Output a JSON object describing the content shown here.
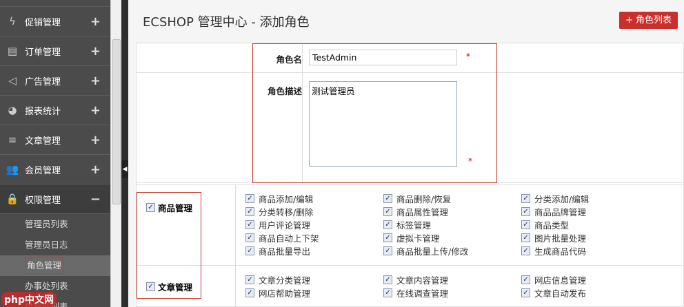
{
  "sidebar": {
    "items": [
      {
        "label": "促销管理",
        "icon": "lightning-icon",
        "toggle": "+"
      },
      {
        "label": "订单管理",
        "icon": "clipboard-icon",
        "toggle": "+"
      },
      {
        "label": "广告管理",
        "icon": "speaker-icon",
        "toggle": "+"
      },
      {
        "label": "报表统计",
        "icon": "pie-chart-icon",
        "toggle": "+"
      },
      {
        "label": "文章管理",
        "icon": "lines-icon",
        "toggle": "+"
      },
      {
        "label": "会员管理",
        "icon": "users-icon",
        "toggle": "+"
      },
      {
        "label": "权限管理",
        "icon": "lock-icon",
        "toggle": "−"
      }
    ],
    "subitems": [
      "管理员列表",
      "管理员日志",
      "角色管理",
      "办事处列表",
      "供货商列表"
    ]
  },
  "header": {
    "title": "ECSHOP 管理中心 - 添加角色",
    "button": "角色列表"
  },
  "form": {
    "name_label": "角色名",
    "name_value": "TestAdmin",
    "desc_label": "角色描述",
    "desc_value": "测试管理员",
    "required": "*"
  },
  "groups": [
    {
      "label": "商品管理",
      "items": [
        "商品添加/编辑",
        "商品删除/恢复",
        "分类添加/编辑",
        "分类转移/删除",
        "商品属性管理",
        "商品品牌管理",
        "用户评论管理",
        "标签管理",
        "商品类型",
        "商品自动上下架",
        "虚拟卡管理",
        "图片批量处理",
        "商品批量导出",
        "商品批量上传/修改",
        "生成商品代码"
      ]
    },
    {
      "label": "文章管理",
      "items": [
        "文章分类管理",
        "文章内容管理",
        "网店信息管理",
        "网店帮助管理",
        "在线调查管理",
        "文章自动发布"
      ]
    }
  ],
  "watermark": "php中文网"
}
